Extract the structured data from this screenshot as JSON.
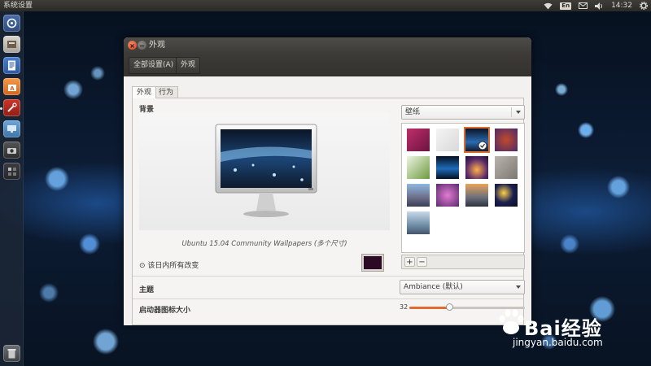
{
  "top_panel": {
    "title": "系统设置",
    "keyboard_badge": "En",
    "time": "14:32"
  },
  "window": {
    "title": "外观",
    "toolbar": {
      "all_settings": "全部设置(A)",
      "breadcrumb": "外观"
    },
    "tabs": [
      {
        "label": "外观",
        "active": true
      },
      {
        "label": "行为",
        "active": false
      }
    ],
    "background": {
      "section_label": "背景",
      "source_combo_value": "壁纸",
      "caption": "Ubuntu 15.04 Community Wallpapers (多个尺寸)",
      "day_change_label": "该日内所有改变",
      "swatch_color": "#2c0a26",
      "add_label": "+",
      "remove_label": "−",
      "selected_thumbnail": 3
    },
    "theme": {
      "section_label": "主题",
      "combo_value": "Ambiance (默认)"
    },
    "launcher_icon_size": {
      "section_label": "启动器图标大小",
      "value": "32",
      "level": 0.35
    }
  },
  "colors": {
    "accent": "#e06c2f",
    "panel_dark": "#3d3b37",
    "window_bg": "#f2f1f0"
  },
  "watermark": {
    "brand": "Bai经验",
    "url": "jingyan.baidu.com"
  }
}
